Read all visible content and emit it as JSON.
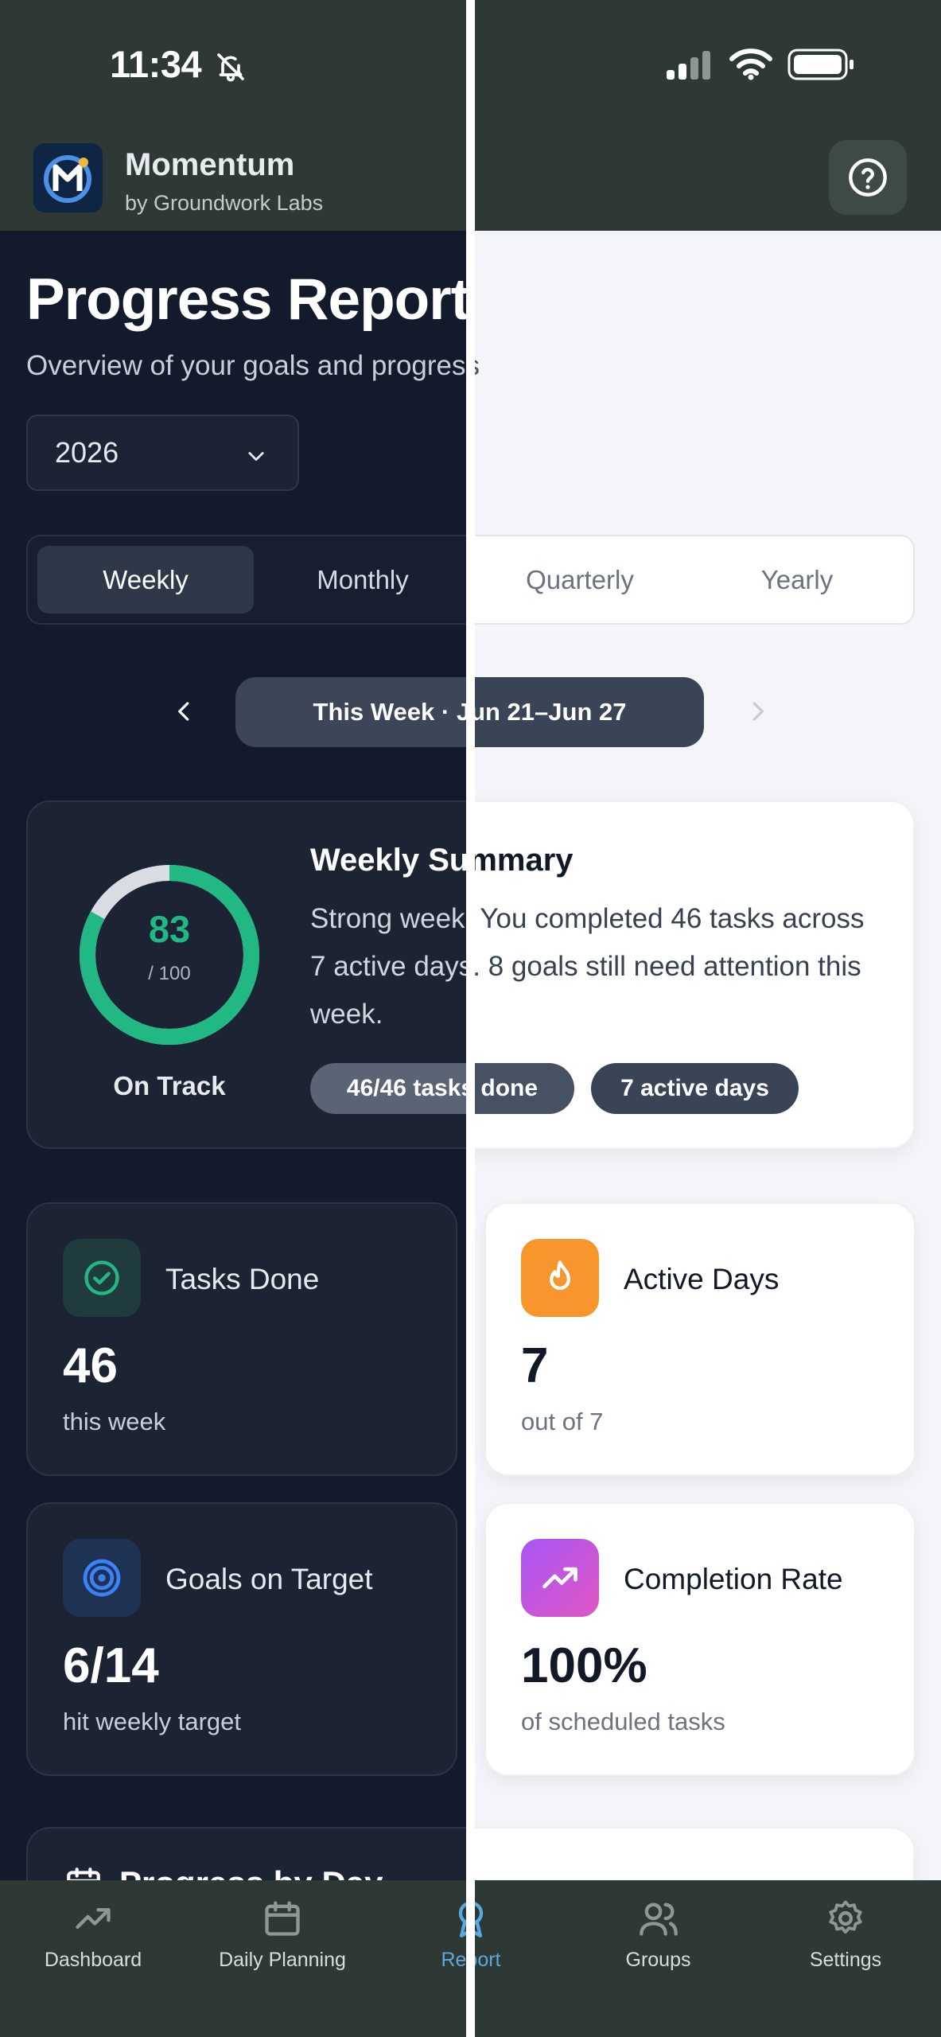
{
  "status_bar": {
    "time": "11:34",
    "icons": [
      "bell-muted-icon",
      "cellular-signal-icon",
      "wifi-icon",
      "battery-icon"
    ]
  },
  "app": {
    "name": "Momentum",
    "byline": "by Groundwork Labs",
    "logo_icon": "momentum-logo",
    "help_icon": "help-circle-icon"
  },
  "page": {
    "title": "Progress Report",
    "subtitle": "Overview of your goals and progress"
  },
  "year_select": {
    "value": "2026",
    "icon": "chevron-down-icon"
  },
  "period_tabs": [
    {
      "label": "Weekly",
      "active": true
    },
    {
      "label": "Monthly",
      "active": false
    },
    {
      "label": "Quarterly",
      "active": false
    },
    {
      "label": "Yearly",
      "active": false
    }
  ],
  "range": {
    "label": "This Week · Jun 21–Jun 27",
    "prev_icon": "chevron-left-icon",
    "next_icon": "chevron-right-icon"
  },
  "summary": {
    "score": "83",
    "score_max": "/ 100",
    "score_fraction": 0.83,
    "status": "On Track",
    "title": "Weekly Summary",
    "text": "Strong week! You completed 46 tasks across 7 active days. 8 goals still need attention this week.",
    "pills": [
      "46/46 tasks done",
      "7 active days"
    ]
  },
  "stats": [
    {
      "title": "Tasks Done",
      "value": "46",
      "caption": "this week",
      "icon": "check-circle-icon",
      "color": "#22b883"
    },
    {
      "title": "Active Days",
      "value": "7",
      "caption": "out of 7",
      "icon": "flame-icon",
      "color": "#f7962d"
    },
    {
      "title": "Goals on Target",
      "value": "6/14",
      "caption": "hit weekly target",
      "icon": "target-icon",
      "color": "#3b82f6"
    },
    {
      "title": "Completion Rate",
      "value": "100%",
      "caption": "of scheduled tasks",
      "icon": "trending-up-icon",
      "color": "#c04fd8"
    }
  ],
  "next_section": {
    "title": "Progress by Day",
    "icon": "calendar-icon"
  },
  "bottom_nav": [
    {
      "label": "Dashboard",
      "icon": "trend-line-icon",
      "active": false
    },
    {
      "label": "Daily Planning",
      "icon": "calendar-icon",
      "active": false
    },
    {
      "label": "Report",
      "icon": "award-ribbon-icon",
      "active": true
    },
    {
      "label": "Groups",
      "icon": "users-icon",
      "active": false
    },
    {
      "label": "Settings",
      "icon": "gear-icon",
      "active": false
    }
  ],
  "colors": {
    "accent_green": "#22b883",
    "accent_orange": "#f7962d",
    "accent_blue": "#3b82f6",
    "accent_purple": "#c04fd8",
    "nav_active": "#5aa9de",
    "chrome": "#2e3936",
    "dark_bg": "#131a2b",
    "light_bg": "#f3f5f8"
  }
}
